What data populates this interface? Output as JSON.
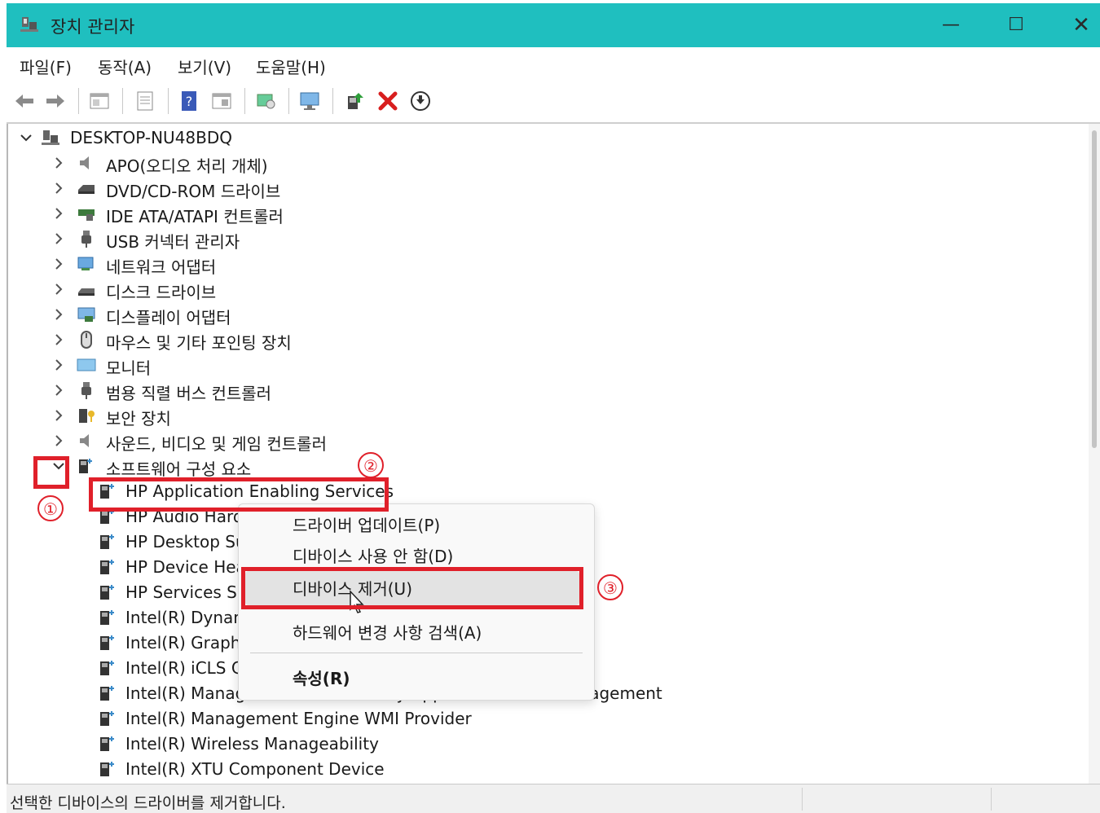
{
  "window": {
    "title": "장치 관리자",
    "controls": {
      "minimize": "—",
      "maximize": "☐",
      "close": "✕"
    }
  },
  "menubar": {
    "items": [
      "파일(F)",
      "동작(A)",
      "보기(V)",
      "도움말(H)"
    ]
  },
  "toolbar": {
    "icons": [
      "back-icon",
      "forward-icon",
      "properties-view-icon",
      "details-icon",
      "help-icon",
      "view-icon",
      "scan-hardware-icon",
      "monitor-icon",
      "update-driver-icon",
      "uninstall-icon",
      "download-icon"
    ]
  },
  "tree": {
    "root": "DESKTOP-NU48BDQ",
    "categories": [
      "APO(오디오 처리 개체)",
      "DVD/CD-ROM 드라이브",
      "IDE ATA/ATAPI 컨트롤러",
      "USB 커넥터 관리자",
      "네트워크 어댑터",
      "디스크 드라이브",
      "디스플레이 어댑터",
      "마우스 및 기타 포인팅 장치",
      "모니터",
      "범용 직렬 버스 컨트롤러",
      "보안 장치",
      "사운드, 비디오 및 게임 컨트롤러",
      "소프트웨어 구성 요소"
    ],
    "expanded_children": [
      "HP Application Enabling Services",
      "HP Audio Hard",
      "HP Desktop Su",
      "HP Device Hea",
      "HP Services Sc",
      "Intel(R) Dynam",
      "Intel(R) Graphi",
      "Intel(R) iCLS C",
      "Intel(R) Management and Security Application Local Management",
      "Intel(R) Management Engine WMI Provider",
      "Intel(R) Wireless Manageability",
      "Intel(R) XTU Component Device"
    ]
  },
  "context_menu": {
    "items": [
      "드라이버 업데이트(P)",
      "디바이스 사용 안 함(D)",
      "디바이스 제거(U)",
      "하드웨어 변경 사항 검색(A)",
      "속성(R)"
    ],
    "highlighted": "디바이스 제거(U)"
  },
  "annotations": {
    "step1": "①",
    "step2": "②",
    "step3": "③",
    "color": "#e0202a"
  },
  "status_bar": {
    "text": "선택한 디바이스의 드라이버를 제거합니다."
  },
  "colors": {
    "titlebar": "#1fbfbf",
    "annotation": "#e0202a"
  }
}
